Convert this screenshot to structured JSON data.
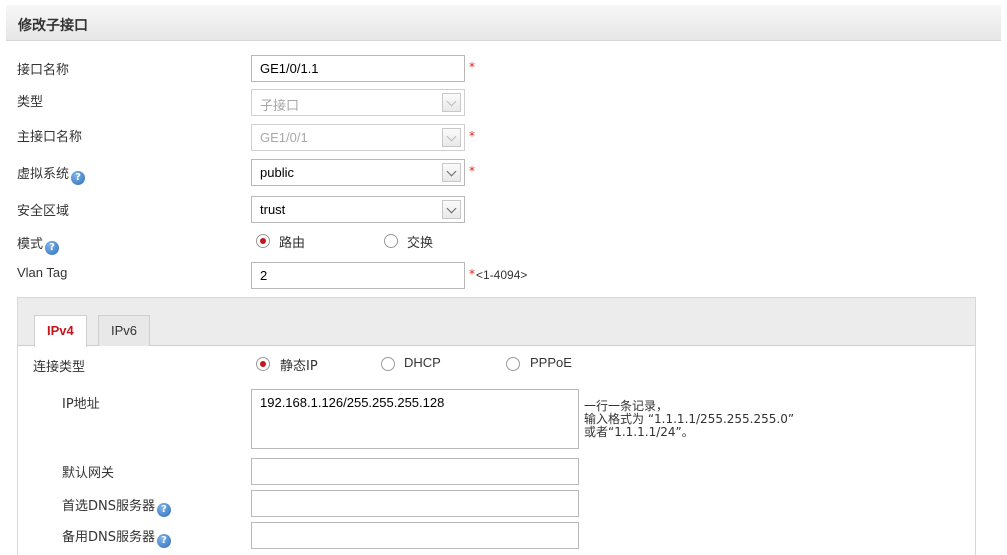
{
  "header": {
    "title": "修改子接口"
  },
  "form": {
    "iface_name": {
      "label": "接口名称",
      "value": "GE1/0/1.1",
      "required": "*"
    },
    "type": {
      "label": "类型",
      "value": "子接口"
    },
    "main_iface": {
      "label": "主接口名称",
      "value": "GE1/0/1",
      "required": "*"
    },
    "vsys": {
      "label": "虚拟系统",
      "value": "public",
      "required": "*"
    },
    "zone": {
      "label": "安全区域",
      "value": "trust"
    },
    "mode": {
      "label": "模式",
      "options": [
        "路由",
        "交换"
      ],
      "selected": "路由"
    },
    "vlan": {
      "label": "Vlan Tag",
      "value": "2",
      "required": "*",
      "range": "<1-4094>"
    }
  },
  "tabs": [
    {
      "label": "IPv4",
      "active": true
    },
    {
      "label": "IPv6",
      "active": false
    }
  ],
  "ipv4": {
    "conn_type": {
      "label": "连接类型",
      "options": [
        "静态IP",
        "DHCP",
        "PPPoE"
      ],
      "selected": "静态IP"
    },
    "ip_addr": {
      "label": "IP地址",
      "value": "192.168.1.126/255.255.255.128",
      "note_line1": "一行一条记录，",
      "note_line2": "输入格式为 “1.1.1.1/255.255.255.0”",
      "note_line3": "或者“1.1.1.1/24”。"
    },
    "gateway": {
      "label": "默认网关",
      "value": ""
    },
    "dns1": {
      "label": "首选DNS服务器",
      "value": ""
    },
    "dns2": {
      "label": "备用DNS服务器",
      "value": ""
    }
  },
  "icons": {
    "help": "help-icon",
    "dropdown": "chevron-down-icon"
  },
  "colors": {
    "accent": "#c4161c",
    "required": "#e2231a",
    "help": "#2f6fb8"
  }
}
